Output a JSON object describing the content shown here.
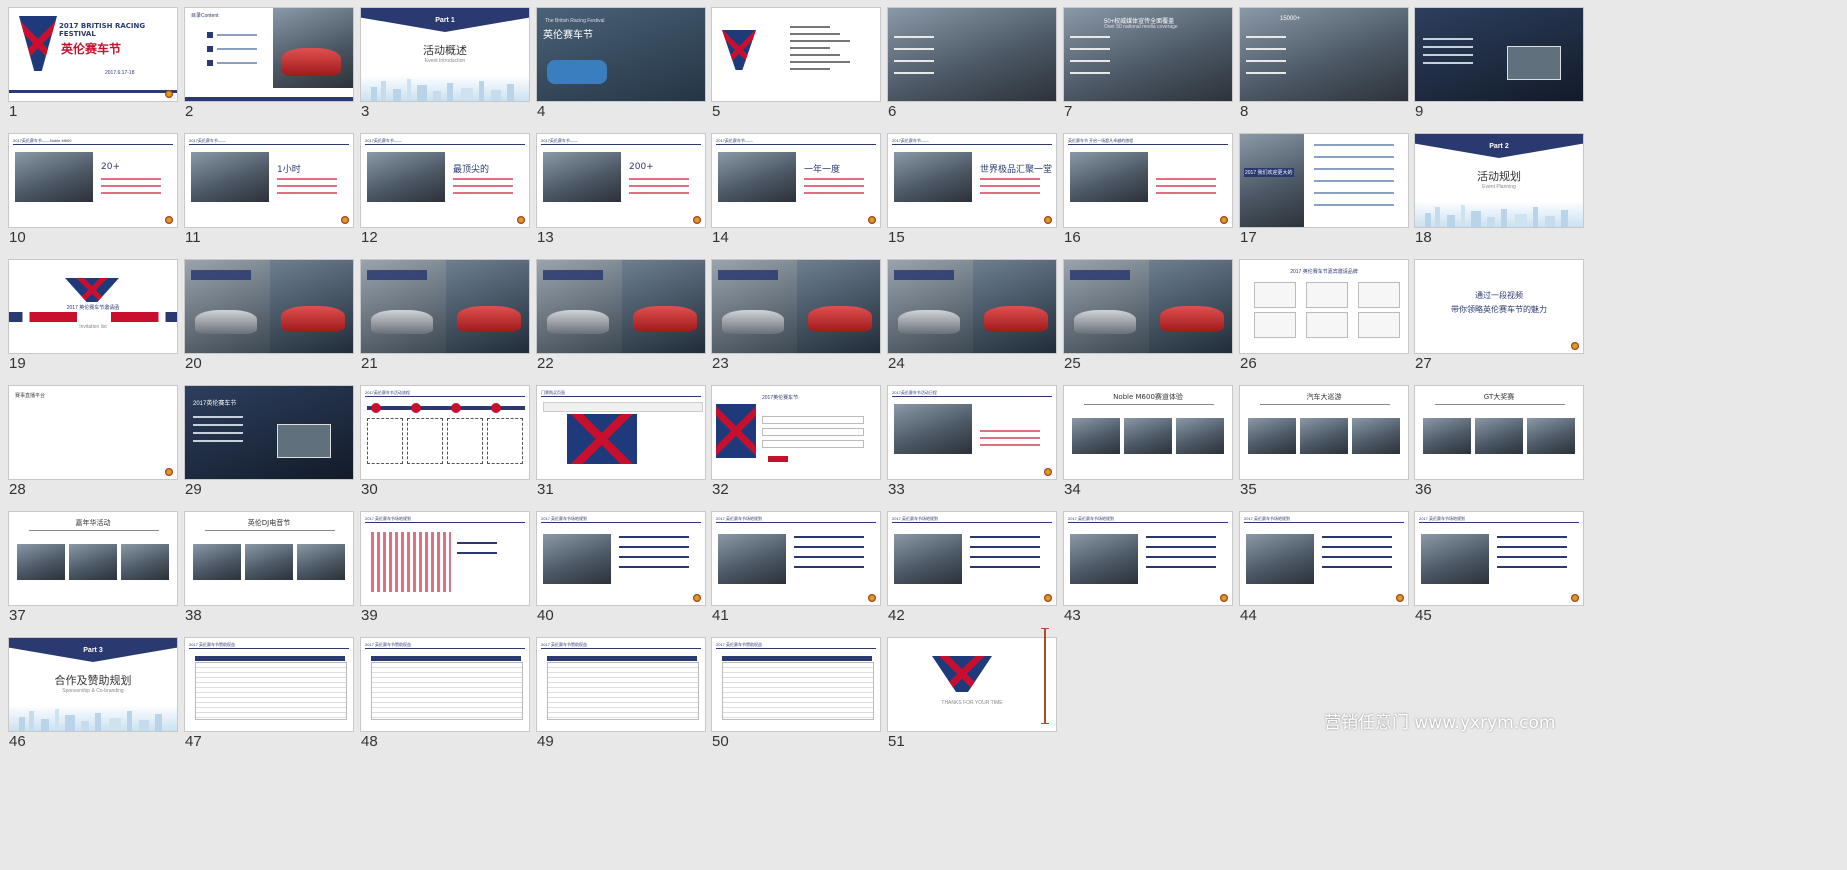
{
  "slides": [
    {
      "n": "1",
      "kind": "cover",
      "title": "2017 BRITISH RACING FESTIVAL",
      "subtitle": "英伦赛车节",
      "date": "2017.6.17-18"
    },
    {
      "n": "2",
      "kind": "toc",
      "title": "目录Content"
    },
    {
      "n": "3",
      "kind": "section",
      "part": "Part 1",
      "title": "活动概述",
      "sub": "Event Introduction"
    },
    {
      "n": "4",
      "kind": "photo-title",
      "title": "英伦赛车节",
      "sub": "The British Racing Festival"
    },
    {
      "n": "5",
      "kind": "logo-list"
    },
    {
      "n": "6",
      "kind": "photo-stats"
    },
    {
      "n": "7",
      "kind": "photo-stats",
      "title": "50+权威媒体宣传全面覆盖",
      "sub": "Over 50 national media coverage"
    },
    {
      "n": "8",
      "kind": "photo-stats",
      "title": "15000+"
    },
    {
      "n": "9",
      "kind": "dark-photo"
    },
    {
      "n": "10",
      "kind": "content",
      "header": "2017英伦赛车节——Noble M600",
      "title": "20+"
    },
    {
      "n": "11",
      "kind": "content",
      "header": "2017英伦赛车节——",
      "title": "1小时"
    },
    {
      "n": "12",
      "kind": "content",
      "header": "2017英伦赛车节——",
      "title": "最顶尖的"
    },
    {
      "n": "13",
      "kind": "content",
      "header": "2017英伦赛车节——",
      "title": "200+"
    },
    {
      "n": "14",
      "kind": "content",
      "header": "2017英伦赛车节——",
      "title": "一年一度"
    },
    {
      "n": "15",
      "kind": "content",
      "header": "2017英伦赛车节——",
      "title": "世界极品汇聚一堂"
    },
    {
      "n": "16",
      "kind": "content",
      "header": "英伦赛车节 开启一场超凡卓越的旅程"
    },
    {
      "n": "17",
      "kind": "photo-list",
      "title": "2017 我们欢迎更大的"
    },
    {
      "n": "18",
      "kind": "section",
      "part": "Part 2",
      "title": "活动规划",
      "sub": "Event Planning"
    },
    {
      "n": "19",
      "kind": "invite",
      "title": "2017 英伦赛车节邀请函",
      "sub": "Invitation list"
    },
    {
      "n": "20",
      "kind": "cars"
    },
    {
      "n": "21",
      "kind": "cars"
    },
    {
      "n": "22",
      "kind": "cars"
    },
    {
      "n": "23",
      "kind": "cars"
    },
    {
      "n": "24",
      "kind": "cars"
    },
    {
      "n": "25",
      "kind": "cars"
    },
    {
      "n": "26",
      "kind": "brands",
      "title": "2017 英伦赛车节嘉宾邀请品牌"
    },
    {
      "n": "27",
      "kind": "text",
      "title": "通过一段视频",
      "sub": "带你领略英伦赛车节的魅力"
    },
    {
      "n": "28",
      "kind": "blank",
      "header": "赛事直播平台"
    },
    {
      "n": "29",
      "kind": "dark-photo",
      "title": "2017英伦赛车节"
    },
    {
      "n": "30",
      "kind": "timeline",
      "header": "2017英伦赛车节活动流程"
    },
    {
      "n": "31",
      "kind": "web",
      "header": "门票购买页面"
    },
    {
      "n": "32",
      "kind": "form",
      "header": "2017英伦赛车节"
    },
    {
      "n": "33",
      "kind": "content",
      "header": "2017英伦赛车节活动日程"
    },
    {
      "n": "34",
      "kind": "gallery",
      "title": "Noble M600赛道体验"
    },
    {
      "n": "35",
      "kind": "gallery",
      "title": "汽车大巡游"
    },
    {
      "n": "36",
      "kind": "gallery",
      "title": "GT大奖赛"
    },
    {
      "n": "37",
      "kind": "gallery",
      "title": "嘉年华活动"
    },
    {
      "n": "38",
      "kind": "gallery",
      "title": "英伦DJ电音节"
    },
    {
      "n": "39",
      "kind": "map",
      "header": "2017 英伦赛车节场地规划"
    },
    {
      "n": "40",
      "kind": "venue",
      "header": "2017 英伦赛车节场地规划"
    },
    {
      "n": "41",
      "kind": "venue",
      "header": "2017 英伦赛车节场地规划"
    },
    {
      "n": "42",
      "kind": "venue",
      "header": "2017 英伦赛车节场地规划"
    },
    {
      "n": "43",
      "kind": "venue",
      "header": "2017 英伦赛车节场地规划"
    },
    {
      "n": "44",
      "kind": "venue",
      "header": "2017 英伦赛车节场地规划"
    },
    {
      "n": "45",
      "kind": "venue",
      "header": "2017 英伦赛车节场地规划"
    },
    {
      "n": "46",
      "kind": "section",
      "part": "Part 3",
      "title": "合作及赞助规划",
      "sub": "Sponsorship & Co-branding"
    },
    {
      "n": "47",
      "kind": "table",
      "header": "2017 英伦赛车节赞助权益"
    },
    {
      "n": "48",
      "kind": "table",
      "header": "2017 英伦赛车节赞助权益"
    },
    {
      "n": "49",
      "kind": "table",
      "header": "2017 英伦赛车节赞助权益"
    },
    {
      "n": "50",
      "kind": "table",
      "header": "2017 英伦赛车节赞助权益"
    },
    {
      "n": "51",
      "kind": "thanks",
      "sub": "THANKS FOR YOUR TIME"
    }
  ],
  "watermark": "营销任意门 www.yxrym.com",
  "colors": {
    "navy": "#2a3a70",
    "red": "#c8102e",
    "background": "#e8e8e8"
  }
}
